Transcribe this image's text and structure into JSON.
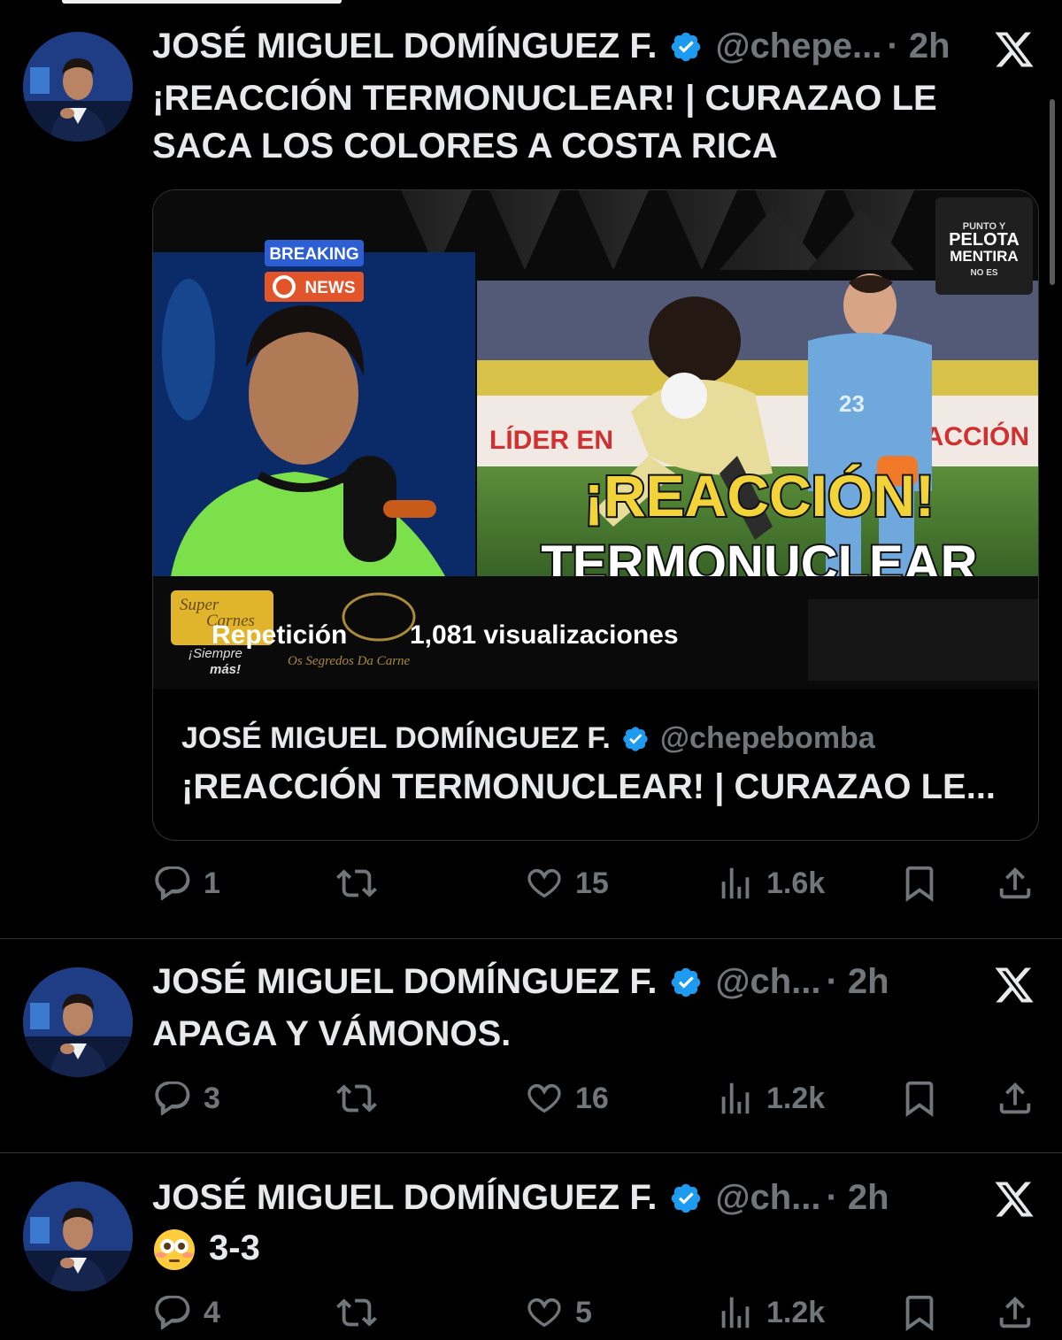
{
  "colors": {
    "background": "#000000",
    "text": "#e7e9ea",
    "muted": "#71767b",
    "verified": "#1d9bf0",
    "divider": "#2f3336"
  },
  "tweets": [
    {
      "author": "JOSÉ MIGUEL DOMÍNGUEZ F.",
      "handle": "@chepe...",
      "time": "· 2h",
      "text_lines": [
        "¡REACCIÓN TERMONUCLEAR! | CURAZAO LE",
        "SACA LOS COLORES A COSTA RICA"
      ],
      "card": {
        "overlay": {
          "breaking": "BREAKING",
          "news": "NEWS",
          "replay": "Repetición",
          "views": "1,081 visualizaciones",
          "headline_1": "¡REACCIÓN!",
          "headline_2": "TERMONUCLEAR",
          "banner": "LÍDER EN",
          "banner_right": "ACCIÓN",
          "logo_top": "PUNTO Y",
          "logo_main_1": "PELOTA",
          "logo_main_2": "MENTIRA",
          "logo_bottom": "NO ES",
          "sponsor_1a": "Super",
          "sponsor_1b": "Carnes",
          "sponsor_1c": "¡Siempre",
          "sponsor_1d": "más!",
          "sponsor_2": "Os Segredos Da Carne",
          "jersey_number": "23"
        },
        "author": "JOSÉ MIGUEL DOMÍNGUEZ F.",
        "handle": "@chepebomba",
        "title": "¡REACCIÓN TERMONUCLEAR! | CURAZAO LE..."
      },
      "stats": {
        "replies": "1",
        "likes": "15",
        "views": "1.6k"
      }
    },
    {
      "author": "JOSÉ MIGUEL DOMÍNGUEZ F.",
      "handle": "@ch...",
      "time": "· 2h",
      "text": "APAGA Y VÁMONOS.",
      "stats": {
        "replies": "3",
        "likes": "16",
        "views": "1.2k"
      }
    },
    {
      "author": "JOSÉ MIGUEL DOMÍNGUEZ F.",
      "handle": "@ch...",
      "time": "· 2h",
      "emoji": "flushed-face-emoji",
      "text": "3-3",
      "stats": {
        "replies": "4",
        "likes": "5",
        "views": "1.2k"
      }
    }
  ],
  "icons": [
    "verified-badge-icon",
    "x-logo-icon",
    "reply-icon",
    "retweet-icon",
    "like-icon",
    "views-icon",
    "bookmark-icon",
    "share-icon"
  ]
}
